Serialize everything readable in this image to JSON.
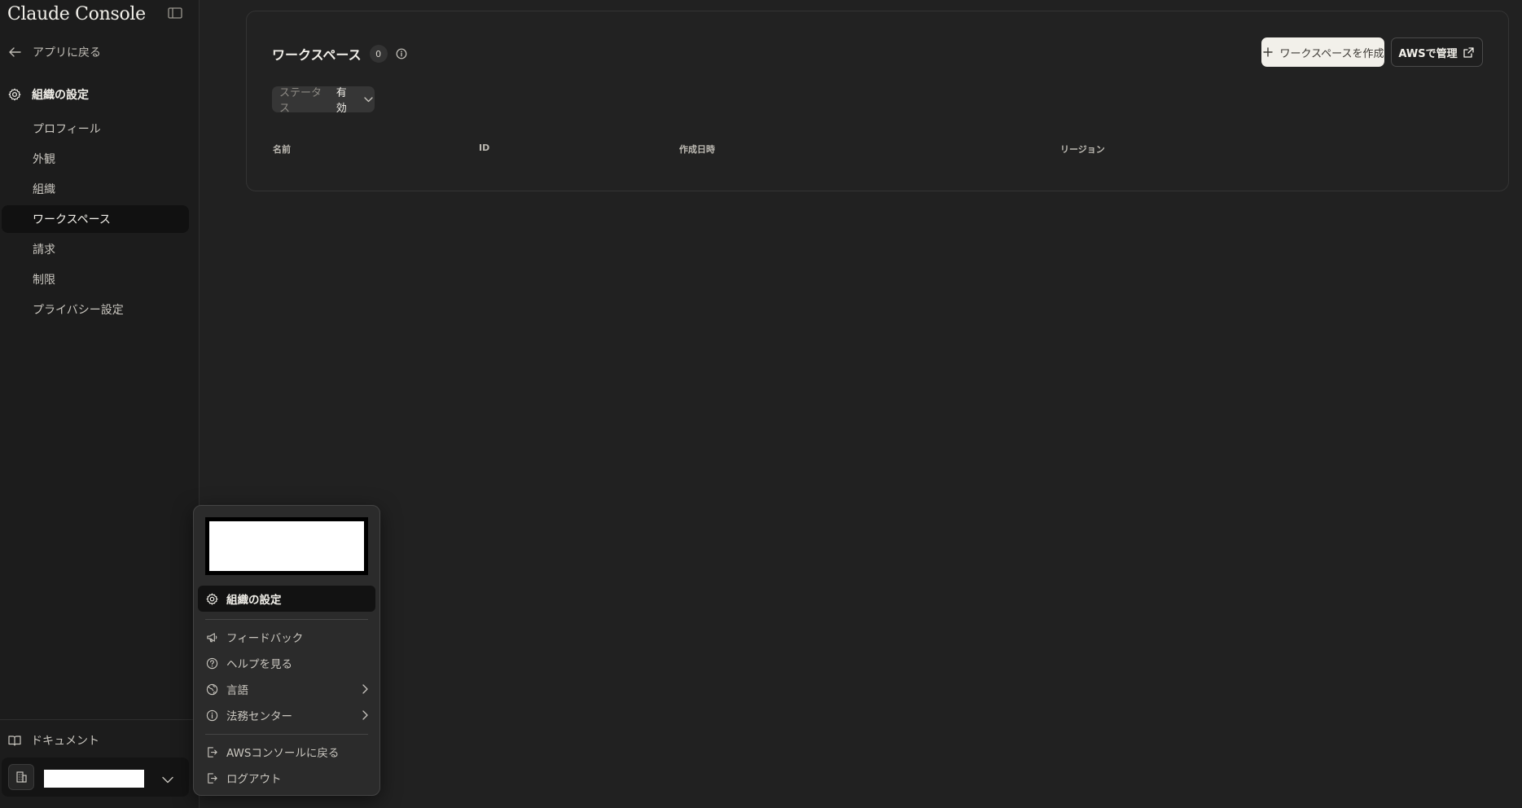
{
  "sidebar": {
    "brand": "Claude Console",
    "back_label": "アプリに戻る",
    "section_title": "組織の設定",
    "items": [
      {
        "label": "プロフィール",
        "active": false
      },
      {
        "label": "外観",
        "active": false
      },
      {
        "label": "組織",
        "active": false
      },
      {
        "label": "ワークスペース",
        "active": true
      },
      {
        "label": "請求",
        "active": false
      },
      {
        "label": "制限",
        "active": false
      },
      {
        "label": "プライバシー設定",
        "active": false
      }
    ],
    "docs_label": "ドキュメント"
  },
  "main": {
    "title": "ワークスペース",
    "count": "0",
    "create_button": "ワークスペースを作成",
    "aws_button": "AWSで管理",
    "filter": {
      "label": "ステータス",
      "value": "有効"
    },
    "columns": [
      "名前",
      "ID",
      "作成日時",
      "リージョン"
    ]
  },
  "menu": {
    "items": [
      {
        "label": "組織の設定",
        "icon": "gear-icon"
      },
      {
        "label": "フィードバック",
        "icon": "megaphone-icon"
      },
      {
        "label": "ヘルプを見る",
        "icon": "help-circle-icon"
      },
      {
        "label": "言語",
        "icon": "globe-icon"
      },
      {
        "label": "法務センター",
        "icon": "info-icon"
      },
      {
        "label": "AWSコンソールに戻る",
        "icon": "exit-icon"
      },
      {
        "label": "ログアウト",
        "icon": "logout-icon"
      }
    ]
  },
  "colors": {
    "background": "#212121",
    "sidebar": "#1c1c1c",
    "primary_button": "#f2f0ea",
    "active_item": "#111111"
  }
}
